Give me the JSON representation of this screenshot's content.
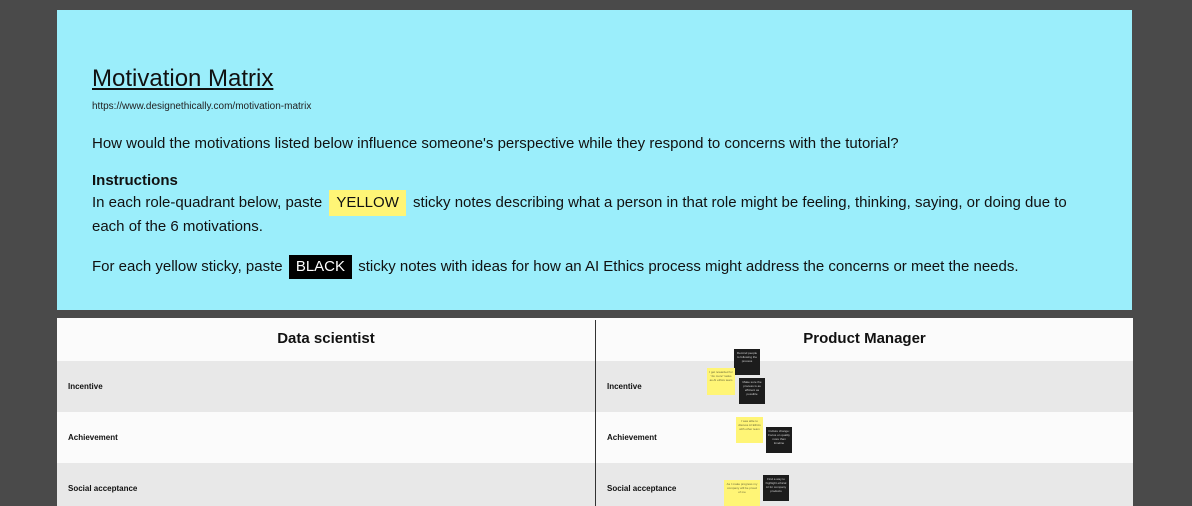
{
  "header": {
    "title": "Motivation Matrix",
    "url": "https://www.designethically.com/motivation-matrix",
    "question": "How would the motivations listed below influence someone's perspective while they respond to concerns with the tutorial?",
    "instructions_heading": "Instructions",
    "instr_part1": "In each role-quadrant below, paste",
    "yellow_tag": "YELLOW",
    "instr_part2": "sticky notes describing what a person in that role might be feeling, thinking, saying, or doing due to each of the 6 motivations.",
    "instr2_part1": "For each yellow sticky, paste",
    "black_tag": "BLACK",
    "instr2_part2": "sticky notes with ideas for how an AI Ethics process might address the concerns or meet the needs."
  },
  "matrix": {
    "columns": [
      "Data scientist",
      "Product Manager"
    ],
    "rows": [
      "Incentive",
      "Achievement",
      "Social acceptance"
    ],
    "stickies": [
      {
        "color": "black",
        "text": "Remind people to following the process"
      },
      {
        "color": "yellow",
        "text": "I get rewarded for \"do more\" tasks as AI ethics team"
      },
      {
        "color": "black",
        "text": "Make sure the process is as efficient as possible"
      },
      {
        "color": "yellow",
        "text": "I was able to discuss AI Ethics with other team"
      },
      {
        "color": "black",
        "text": "Culture change: Focus on quality more than timeline"
      },
      {
        "color": "yellow",
        "text": "As I make progress my company will be proud of me"
      },
      {
        "color": "black",
        "text": "Find a way to highlight ethical AI for company products"
      }
    ]
  }
}
